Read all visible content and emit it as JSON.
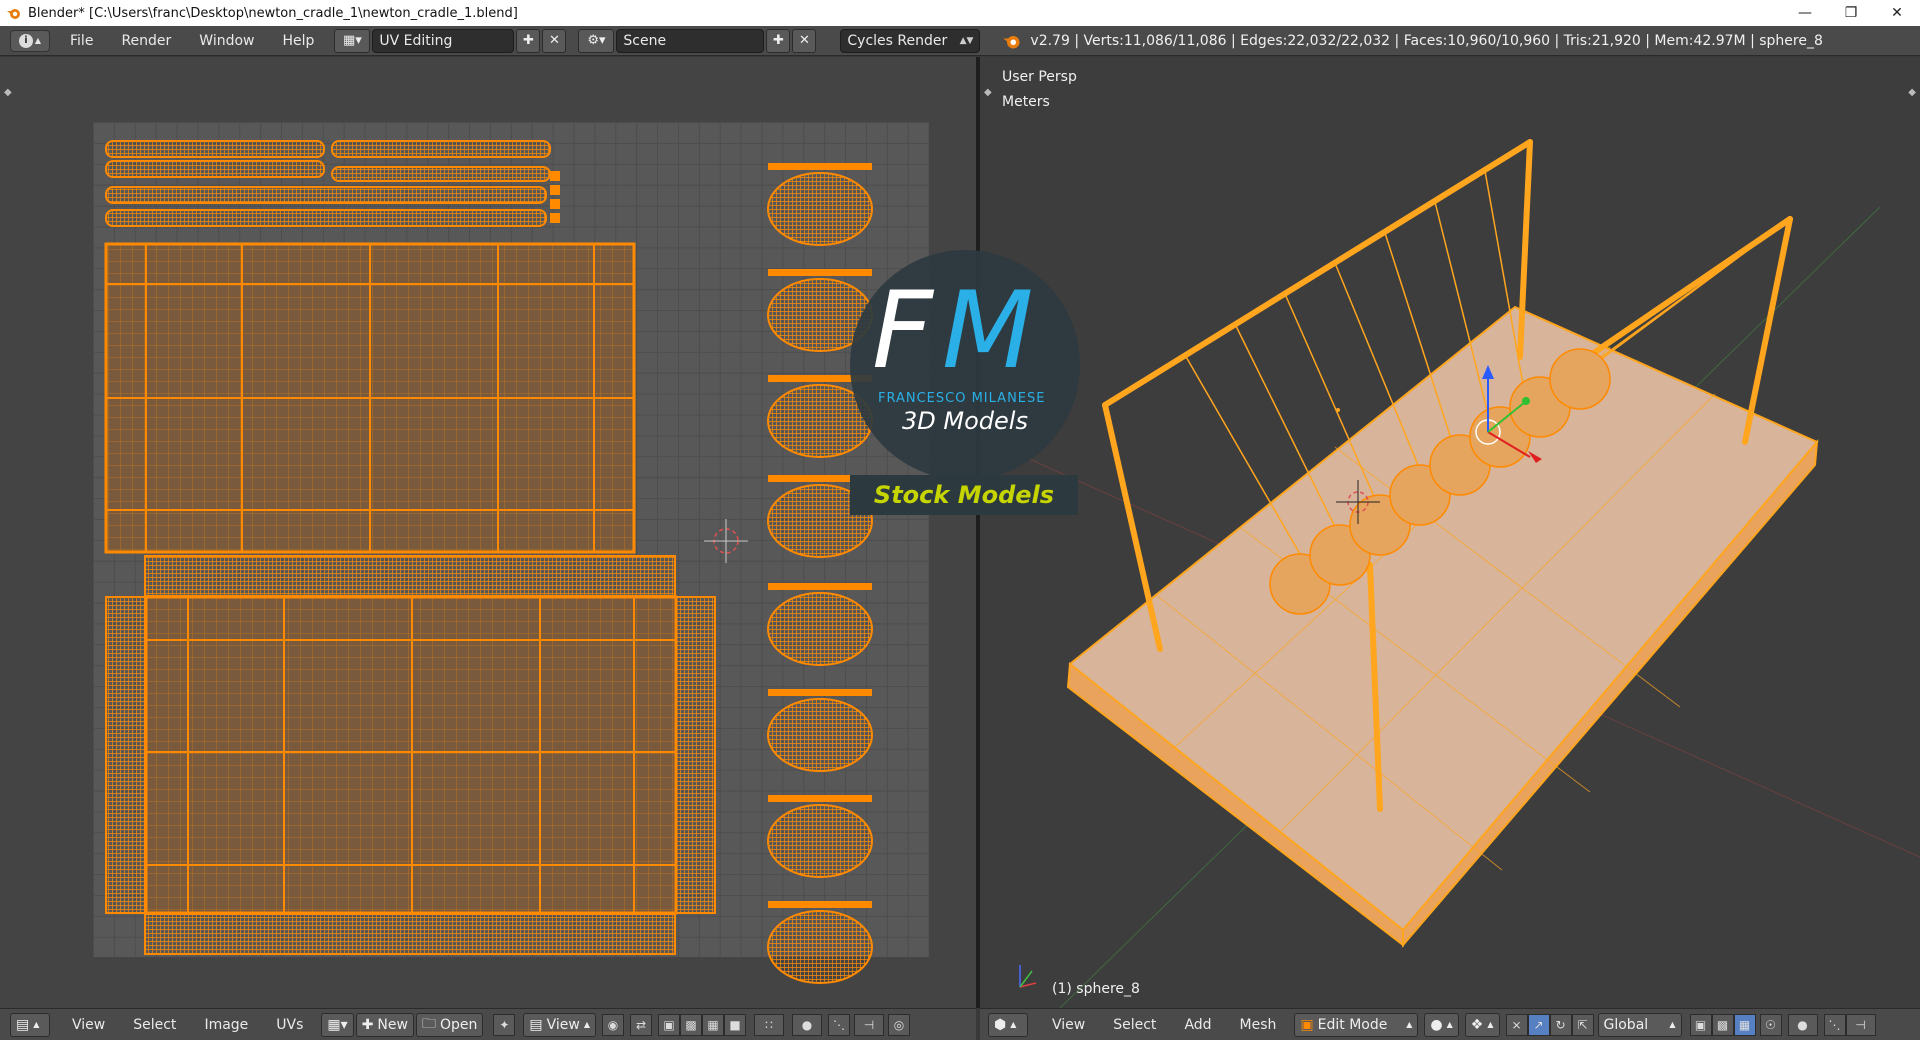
{
  "window": {
    "title": "Blender* [C:\\Users\\franc\\Desktop\\newton_cradle_1\\newton_cradle_1.blend]",
    "minimize_icon": "minimize-icon",
    "restore_icon": "restore-icon",
    "close_icon": "close-icon"
  },
  "info_header": {
    "menus": [
      "File",
      "Render",
      "Window",
      "Help"
    ],
    "screen_layout": "UV Editing",
    "scene": "Scene",
    "render_engine": "Cycles Render",
    "stats": "v2.79 | Verts:11,086/11,086 | Edges:22,032/22,032 | Faces:10,960/10,960 | Tris:21,920 | Mem:42.97M | sphere_8"
  },
  "uv_editor": {
    "menus": [
      "View",
      "Select",
      "Image",
      "UVs"
    ],
    "new_label": "New",
    "open_label": "Open",
    "view_label": "View"
  },
  "viewport_3d": {
    "view_name": "User Persp",
    "units": "Meters",
    "object_label": "(1) sphere_8",
    "menus": [
      "View",
      "Select",
      "Add",
      "Mesh"
    ],
    "mode": "Edit Mode",
    "orientation": "Global"
  },
  "watermark": {
    "initials_f": "F",
    "initials_m": "M",
    "author": "FRANCESCO MILANESE",
    "subtitle": "3D Models",
    "banner": "Stock Models"
  },
  "colors": {
    "selected_orange": "#ff8a00",
    "wire_orange": "#ffa51e",
    "face_fill": "#7a5a3c",
    "base_top": "#d7b49a",
    "base_side": "#e9a35c",
    "logo_dark": "#2c3a40",
    "logo_blue": "#2ab0e6",
    "banner_yellow": "#c6d400"
  }
}
